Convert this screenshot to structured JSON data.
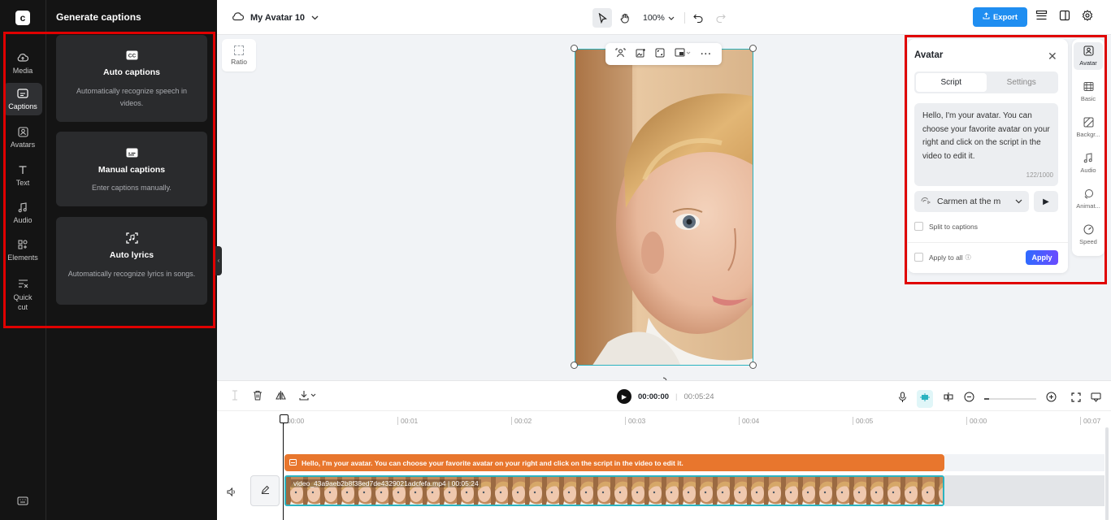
{
  "rail": {
    "items": [
      {
        "label": "Media"
      },
      {
        "label": "Captions"
      },
      {
        "label": "Avatars"
      },
      {
        "label": "Text"
      },
      {
        "label": "Audio"
      },
      {
        "label": "Elements"
      },
      {
        "label": "Quick cut"
      }
    ],
    "active_index": 1
  },
  "captions_panel": {
    "title": "Generate captions",
    "cards": [
      {
        "title": "Auto captions",
        "desc": "Automatically recognize speech in videos."
      },
      {
        "title": "Manual captions",
        "desc": "Enter captions manually."
      },
      {
        "title": "Auto lyrics",
        "desc": "Automatically recognize lyrics in songs."
      }
    ]
  },
  "topbar": {
    "project_name": "My Avatar 10",
    "zoom": "100%",
    "export_label": "Export"
  },
  "canvas": {
    "ratio_label": "Ratio"
  },
  "avatar_panel": {
    "title": "Avatar",
    "tabs": [
      "Script",
      "Settings"
    ],
    "script": "Hello, I'm your avatar. You can choose your favorite avatar on your right and click on the script in the video to edit it.",
    "counter": "122/1000",
    "voice": "Carmen at the m",
    "split_label": "Split to captions",
    "apply_all_label": "Apply to all",
    "apply_label": "Apply"
  },
  "side_tabs": [
    {
      "label": "Avatar"
    },
    {
      "label": "Basic"
    },
    {
      "label": "Backgr..."
    },
    {
      "label": "Audio"
    },
    {
      "label": "Animat..."
    },
    {
      "label": "Speed"
    }
  ],
  "timeline": {
    "current_time": "00:00:00",
    "duration": "00:05:24",
    "ruler": [
      "00:00",
      "00:01",
      "00:02",
      "00:03",
      "00:04",
      "00:05",
      "00:00",
      "00:07"
    ],
    "caption_text": "Hello, I'm your avatar. You can choose your favorite avatar on your right and click on the script in the video to edit it.",
    "video_label": "video_43a9aeb2b8f38ed7de4329021adcfefa.mp4",
    "video_duration": "00:05:24"
  },
  "colors": {
    "accent": "#1f8ef1",
    "caption_track": "#e8762d",
    "selection": "#2bb3c0",
    "highlight": "#e00000"
  }
}
